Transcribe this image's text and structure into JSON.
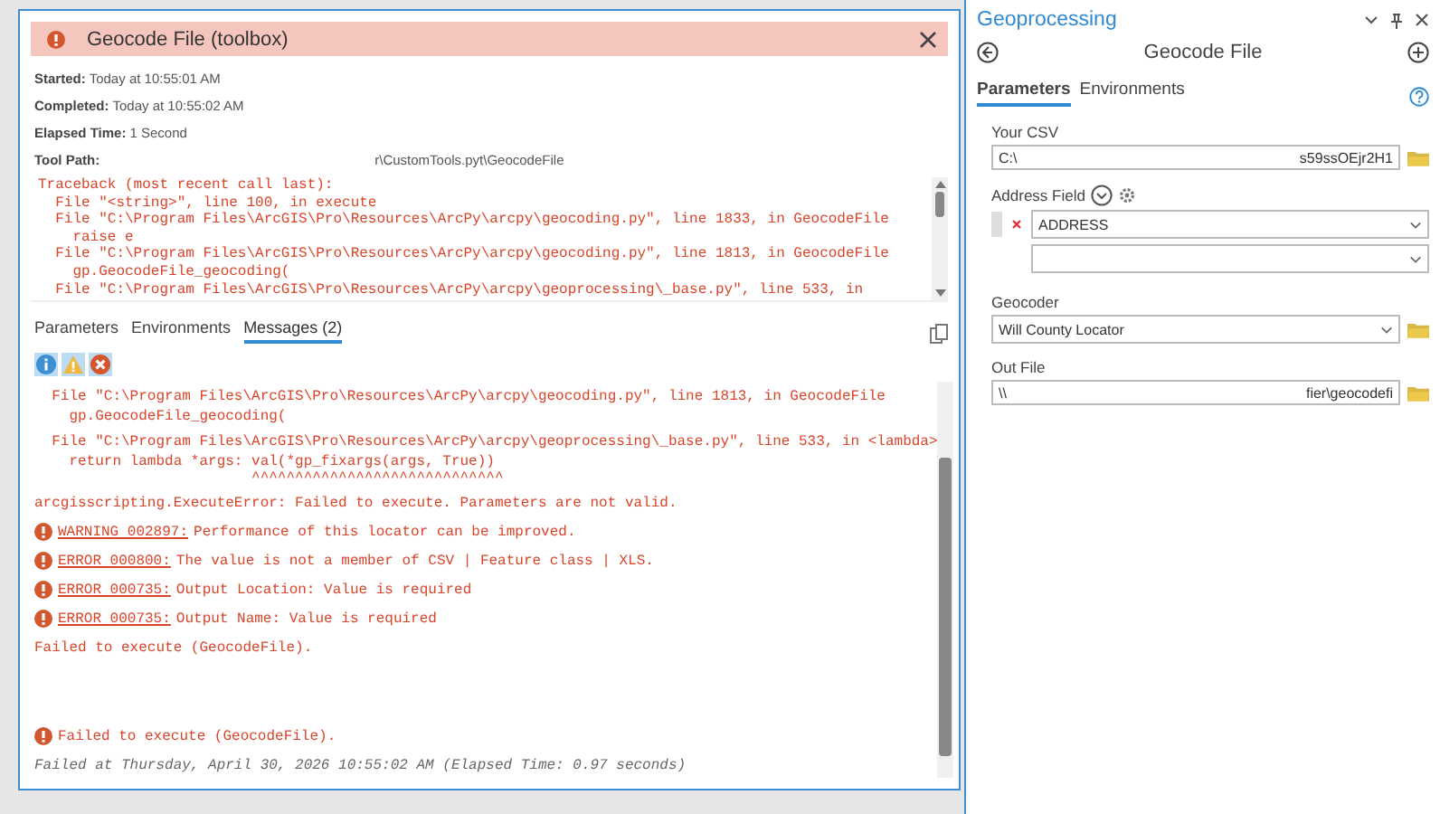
{
  "dialog": {
    "title": "Geocode File (toolbox)",
    "info": [
      {
        "label": "Started:",
        "value": "Today at 10:55:01 AM"
      },
      {
        "label": "Completed:",
        "value": "Today at 10:55:02 AM"
      },
      {
        "label": "Elapsed Time:",
        "value": "1 Second"
      },
      {
        "label": "Tool Path:",
        "value": "r\\CustomTools.pyt\\GeocodeFile"
      }
    ],
    "traceback": [
      "Traceback (most recent call last):",
      "  File \"<string>\", line 100, in execute",
      "  File \"C:\\Program Files\\ArcGIS\\Pro\\Resources\\ArcPy\\arcpy\\geocoding.py\", line 1833, in GeocodeFile",
      "    raise e",
      "  File \"C:\\Program Files\\ArcGIS\\Pro\\Resources\\ArcPy\\arcpy\\geocoding.py\", line 1813, in GeocodeFile",
      "    gp.GeocodeFile_geocoding(",
      "  File \"C:\\Program Files\\ArcGIS\\Pro\\Resources\\ArcPy\\arcpy\\geoprocessing\\_base.py\", line 533, in"
    ],
    "tabs": [
      {
        "label": "Parameters",
        "selected": false
      },
      {
        "label": "Environments",
        "selected": false
      },
      {
        "label": "Messages (2)",
        "selected": true
      }
    ],
    "filters": [
      {
        "kind": "info",
        "on": true
      },
      {
        "kind": "warning",
        "on": true
      },
      {
        "kind": "error",
        "on": true
      }
    ],
    "messages": [
      {
        "kind": "trace",
        "text": "  File \"C:\\Program Files\\ArcGIS\\Pro\\Resources\\ArcPy\\arcpy\\geocoding.py\", line 1813, in GeocodeFile"
      },
      {
        "kind": "cont",
        "text": "    gp.GeocodeFile_geocoding("
      },
      {
        "kind": "trace",
        "text": "  File \"C:\\Program Files\\ArcGIS\\Pro\\Resources\\ArcPy\\arcpy\\geoprocessing\\_base.py\", line 533, in <lambda>"
      },
      {
        "kind": "cont",
        "text": "    return lambda *args: val(*gp_fixargs(args, True))"
      },
      {
        "kind": "cont",
        "text": "                         ^^^^^^^^^^^^^^^^^^^^^^^^^^^^^"
      },
      {
        "kind": "trace",
        "text": "arcgisscripting.ExecuteError: Failed to execute. Parameters are not valid."
      },
      {
        "kind": "warning",
        "code": "WARNING 002897:",
        "text": "Performance of this locator can be improved."
      },
      {
        "kind": "error",
        "code": "ERROR 000800:",
        "text": "The value is not a member of CSV | Feature class | XLS."
      },
      {
        "kind": "error",
        "code": "ERROR 000735:",
        "text": "Output Location: Value is required"
      },
      {
        "kind": "error",
        "code": "ERROR 000735:",
        "text": "Output Name: Value is required"
      },
      {
        "kind": "trace",
        "text": "Failed to execute (GeocodeFile)."
      }
    ],
    "result": "Failed to execute (GeocodeFile).",
    "footer": "Failed at Thursday, April 30, 2026 10:55:02 AM (Elapsed Time: 0.97 seconds)"
  },
  "pane": {
    "title": "Geoprocessing",
    "tool": "Geocode File",
    "tabs": [
      {
        "label": "Parameters",
        "selected": true
      },
      {
        "label": "Environments",
        "selected": false
      }
    ],
    "params": [
      {
        "kind": "file",
        "label": "Your CSV",
        "value_start": "C:\\",
        "value_end": "s59ssOEjr2H1"
      },
      {
        "kind": "fields",
        "label": "Address Field",
        "rows": [
          "ADDRESS",
          ""
        ]
      },
      {
        "kind": "dropdown",
        "label": "Geocoder",
        "value": "Will County Locator"
      },
      {
        "kind": "file",
        "label": "Out File",
        "value_start": "\\\\",
        "value_end": "fier\\geocodefi"
      }
    ]
  }
}
